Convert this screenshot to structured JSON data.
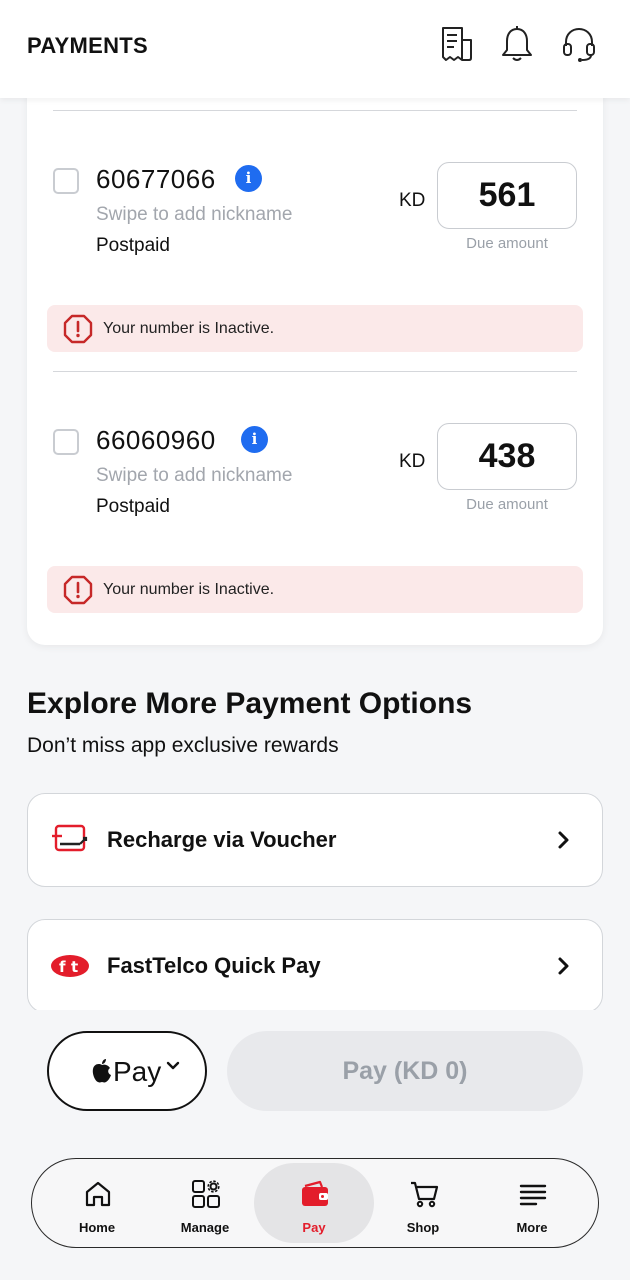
{
  "header": {
    "title": "PAYMENTS",
    "icons": [
      "receipt-icon",
      "bell-icon",
      "headset-icon"
    ]
  },
  "accounts": [
    {
      "number": "60677066",
      "nickname_hint": "Swipe to add nickname",
      "type": "Postpaid",
      "currency": "KD",
      "amount": "561",
      "amount_label": "Due amount",
      "alert": "Your number is Inactive."
    },
    {
      "number": "66060960",
      "nickname_hint": "Swipe to add nickname",
      "type": "Postpaid",
      "currency": "KD",
      "amount": "438",
      "amount_label": "Due amount",
      "alert": "Your number is Inactive."
    }
  ],
  "explore": {
    "title": "Explore More Payment Options",
    "subtitle": "Don’t miss app exclusive rewards",
    "options": [
      {
        "label": "Recharge via Voucher",
        "icon": "voucher-icon"
      },
      {
        "label": "FastTelco Quick Pay",
        "icon": "fasttelco-logo-icon"
      }
    ]
  },
  "pay_bar": {
    "wallet_label": "Pay",
    "pay_button": "Pay (KD 0)"
  },
  "nav": [
    {
      "label": "Home",
      "icon": "home-icon"
    },
    {
      "label": "Manage",
      "icon": "manage-icon"
    },
    {
      "label": "Pay",
      "icon": "wallet-icon",
      "active": true
    },
    {
      "label": "Shop",
      "icon": "cart-icon"
    },
    {
      "label": "More",
      "icon": "menu-icon"
    }
  ],
  "colors": {
    "accent": "#e31d2b",
    "info": "#1f6cf0",
    "alert_bg": "#fbe9e9",
    "alert_icon": "#c62828"
  }
}
